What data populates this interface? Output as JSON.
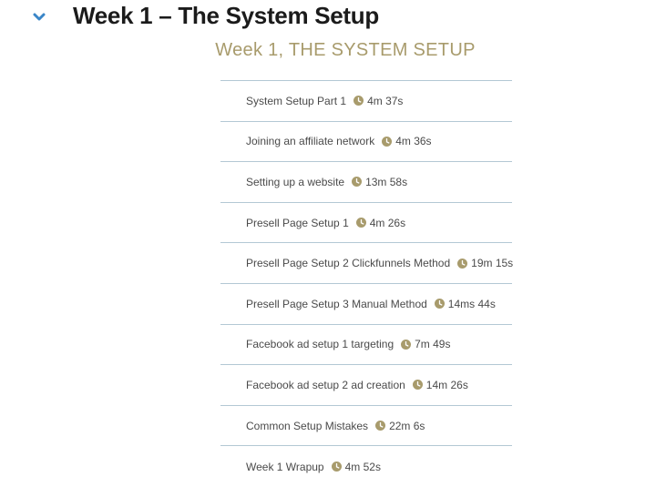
{
  "section": {
    "title": "Week 1 – The System Setup",
    "toggle_icon": "chevron-down-icon",
    "accent_color": "#3a86c8"
  },
  "main": {
    "heading": "Week 1, THE SYSTEM SETUP",
    "heading_color": "#a89b6c",
    "duration_icon": "clock-icon",
    "lessons": [
      {
        "title": "System Setup Part 1",
        "duration": "4m 37s"
      },
      {
        "title": "Joining an affiliate network",
        "duration": "4m 36s"
      },
      {
        "title": "Setting up a website",
        "duration": "13m 58s"
      },
      {
        "title": "Presell Page Setup 1",
        "duration": "4m 26s"
      },
      {
        "title": "Presell Page Setup 2 Clickfunnels Method",
        "duration": "19m 15s"
      },
      {
        "title": "Presell Page Setup 3 Manual Method",
        "duration": "14ms 44s"
      },
      {
        "title": "Facebook ad setup 1 targeting",
        "duration": "7m 49s"
      },
      {
        "title": "Facebook ad setup 2 ad creation",
        "duration": "14m 26s"
      },
      {
        "title": "Common Setup Mistakes",
        "duration": "22m 6s"
      },
      {
        "title": "Week 1 Wrapup",
        "duration": "4m 52s"
      }
    ]
  }
}
